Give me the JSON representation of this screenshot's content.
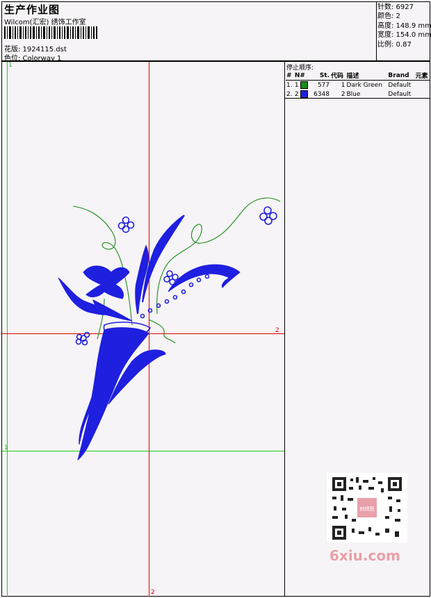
{
  "header": {
    "title": "生产作业图",
    "subtitle": "Wilcom(汇宏) 绣饰工作室",
    "design_line": "花版: 1924115.dst",
    "colorway_line": "色位: Colorway 1"
  },
  "stats": {
    "stitches": "针数: 6927",
    "colors": "颜色: 2",
    "height": "高度: 148.9 mm",
    "width": "宽度: 154.0 mm",
    "scale": "比例: 0.87"
  },
  "stop_sequence": {
    "title": "停止顺序:",
    "columns": [
      "#",
      "N#",
      "St.",
      "代码",
      "描述",
      "Brand",
      "元素"
    ],
    "rows": [
      {
        "index": "1.",
        "needle": "1",
        "swatch": "#1a8a1a",
        "stitches": "577",
        "code": "1",
        "desc": "Dark Green",
        "brand": "Default",
        "element": ""
      },
      {
        "index": "2.",
        "needle": "2",
        "swatch": "#1f1fe0",
        "stitches": "6348",
        "code": "2",
        "desc": "Blue",
        "brand": "Default",
        "element": ""
      }
    ]
  },
  "guides": {
    "green_v": "1",
    "green_h": "1",
    "red_v": "2",
    "red_h": "2"
  },
  "watermark": {
    "qr_logo": "刺绣图",
    "site": "6xiu.com"
  },
  "colors": {
    "thread_green": "#1a8a1a",
    "thread_blue": "#1f1fe0",
    "guide_green": "#22cc22",
    "guide_red": "#e00000"
  }
}
